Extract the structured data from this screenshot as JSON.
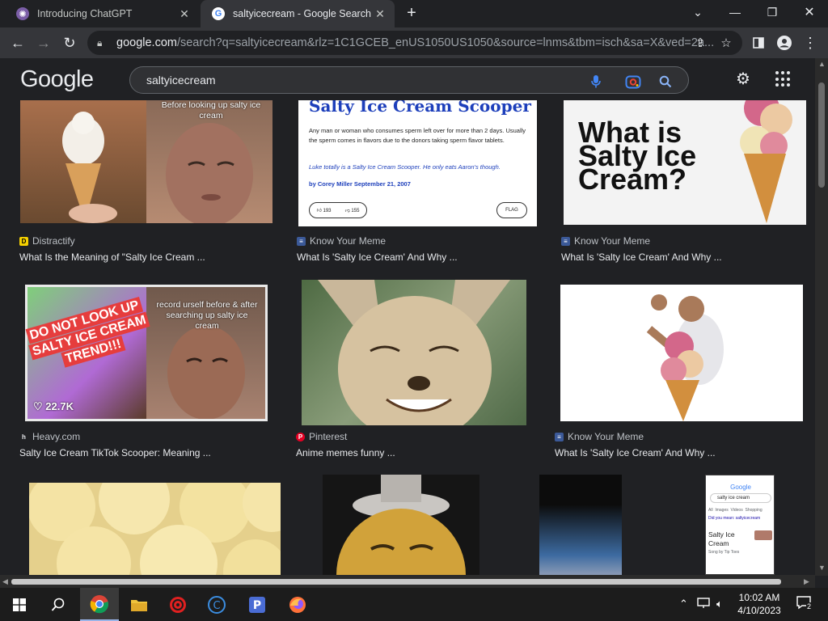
{
  "browser": {
    "tabs": [
      {
        "title": "Introducing ChatGPT",
        "active": false
      },
      {
        "title": "saltyicecream - Google Search",
        "active": true
      }
    ],
    "address": {
      "host": "google.com",
      "path": "/search?q=saltyicecream&rlz=1C1GCEB_enUS1050US1050&source=lnms&tbm=isch&sa=X&ved=2a..."
    }
  },
  "google": {
    "logo": "Google",
    "query": "saltyicecream"
  },
  "results": [
    {
      "source": "Distractify",
      "caption": "What Is the Meaning of \"Salty Ice Cream ...",
      "overlay": "Before looking up salty ice cream"
    },
    {
      "source": "Know Your Meme",
      "caption": "What Is 'Salty Ice Cream' And Why ...",
      "heading": "Salty Ice Cream Scooper",
      "body": "Any man or woman who consumes sperm left over for more than 2 days. Usually the sperm comes in flavors due to the donors taking sperm flavor tablets.",
      "example": "Luke totally is a Salty Ice Cream Scooper. He only eats Aaron's though.",
      "byline": "by Corey Miller September 21, 2007",
      "up": "193",
      "down": "155",
      "flag": "FLAG"
    },
    {
      "source": "Know Your Meme",
      "caption": "What Is 'Salty Ice Cream' And Why ...",
      "heading": "What is Salty Ice Cream?"
    },
    {
      "source": "Heavy.com",
      "caption": "Salty Ice Cream TikTok Scooper: Meaning ...",
      "sticker": "DO NOT LOOK UP SALTY ICE CREAM TREND!!!",
      "overlay": "record urself before & after searching up salty ice cream",
      "likes": "22.7K"
    },
    {
      "source": "Pinterest",
      "caption": "Anime memes funny ..."
    },
    {
      "source": "Know Your Meme",
      "caption": "What Is 'Salty Ice Cream' And Why ..."
    }
  ],
  "mini_search": {
    "query": "salty ice cream",
    "tabs": "All  Images  Videos  Shopping",
    "didyoumean": "Did you mean: saltyicecream",
    "card_title": "Salty Ice Cream",
    "card_sub": "Song by Tip Toes"
  },
  "taskbar": {
    "time": "10:02 AM",
    "date": "4/10/2023",
    "notifications": "2"
  }
}
